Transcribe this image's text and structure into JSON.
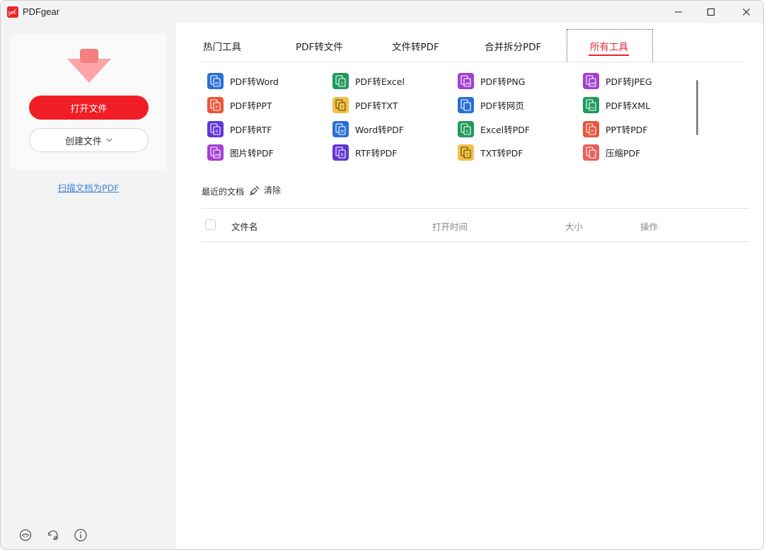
{
  "app": {
    "title": "PDFgear",
    "logo_text": "PDF"
  },
  "sidebar": {
    "open_button": "打开文件",
    "create_button": "创建文件",
    "scan_link": "扫描文档为PDF",
    "bottom_icons": [
      "support-icon",
      "settings-icon",
      "info-icon"
    ]
  },
  "tabs": [
    {
      "label": "热门工具",
      "active": false
    },
    {
      "label": "PDF转文件",
      "active": false
    },
    {
      "label": "文件转PDF",
      "active": false
    },
    {
      "label": "合并拆分PDF",
      "active": false
    },
    {
      "label": "所有工具",
      "active": true
    }
  ],
  "tools": [
    {
      "label": "PDF转Word",
      "color": "#2b6fd6",
      "icon": "word-icon"
    },
    {
      "label": "PDF转Excel",
      "color": "#1f9a5b",
      "icon": "excel-icon"
    },
    {
      "label": "PDF转PNG",
      "color": "#a23fd1",
      "icon": "png-icon"
    },
    {
      "label": "PDF转JPEG",
      "color": "#a23fd1",
      "icon": "jpeg-icon"
    },
    {
      "label": "PDF转PPT",
      "color": "#e8563a",
      "icon": "ppt-icon"
    },
    {
      "label": "PDF转TXT",
      "color": "#f2c14a",
      "icon": "txt-icon"
    },
    {
      "label": "PDF转网页",
      "color": "#2b6fd6",
      "icon": "html-icon"
    },
    {
      "label": "PDF转XML",
      "color": "#1f9a5b",
      "icon": "xml-icon"
    },
    {
      "label": "PDF转RTF",
      "color": "#6236d6",
      "icon": "rtf-icon"
    },
    {
      "label": "Word转PDF",
      "color": "#2b6fd6",
      "icon": "word-icon"
    },
    {
      "label": "Excel转PDF",
      "color": "#1f9a5b",
      "icon": "excel-icon"
    },
    {
      "label": "PPT转PDF",
      "color": "#e8563a",
      "icon": "ppt-icon"
    },
    {
      "label": "图片转PDF",
      "color": "#a23fd1",
      "icon": "image-icon"
    },
    {
      "label": "RTF转PDF",
      "color": "#6236d6",
      "icon": "rtf-icon"
    },
    {
      "label": "TXT转PDF",
      "color": "#f2c14a",
      "icon": "txt-icon"
    },
    {
      "label": "压缩PDF",
      "color": "#e8605a",
      "icon": "compress-icon"
    }
  ],
  "recent": {
    "label": "最近的文档",
    "clear": "清除",
    "columns": {
      "name": "文件名",
      "time": "打开时间",
      "size": "大小",
      "op": "操作"
    }
  },
  "colors": {
    "accent": "#e8262b",
    "link": "#3f84d8"
  }
}
